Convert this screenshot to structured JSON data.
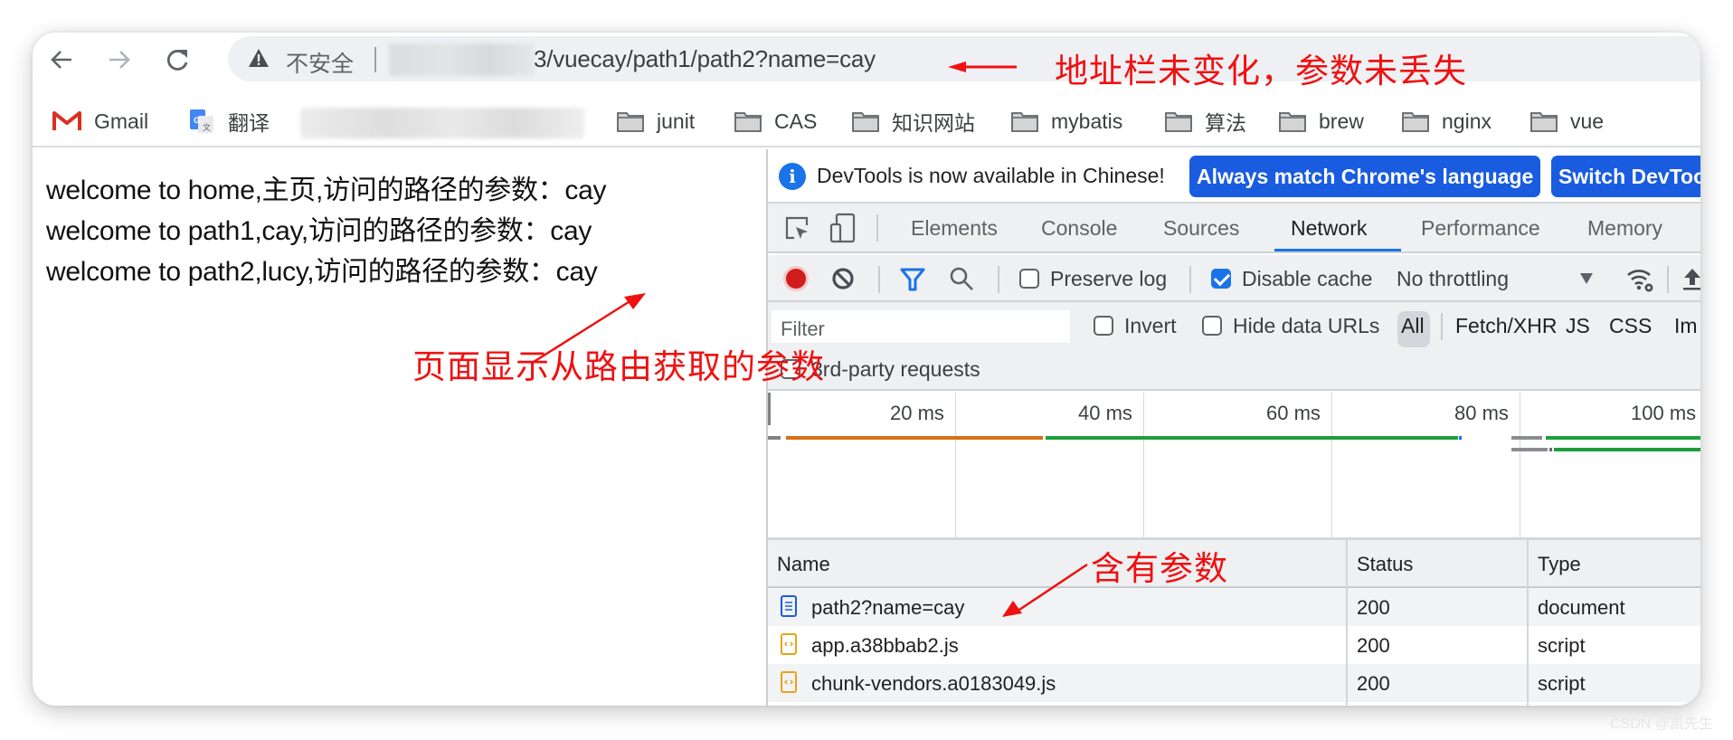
{
  "browser": {
    "nav": {
      "back_icon": "arrow-left-icon",
      "forward_icon": "arrow-right-icon",
      "reload_icon": "reload-icon"
    },
    "omnibox": {
      "security_icon": "warning-triangle-icon",
      "security_label": "不安全",
      "url_visible": "3/vuecay/path1/path2?name=cay"
    },
    "bookmarks": [
      {
        "label": "Gmail",
        "icon": "gmail-icon"
      },
      {
        "label": "翻译",
        "icon": "google-translate-icon"
      },
      {
        "label": "junit",
        "icon": "folder-icon"
      },
      {
        "label": "CAS",
        "icon": "folder-icon"
      },
      {
        "label": "知识网站",
        "icon": "folder-icon"
      },
      {
        "label": "mybatis",
        "icon": "folder-icon"
      },
      {
        "label": "算法",
        "icon": "folder-icon"
      },
      {
        "label": "brew",
        "icon": "folder-icon"
      },
      {
        "label": "nginx",
        "icon": "folder-icon"
      },
      {
        "label": "vue",
        "icon": "folder-icon"
      }
    ]
  },
  "page": {
    "lines": [
      "welcome to home,主页,访问的路径的参数：cay",
      "welcome to path1,cay,访问的路径的参数：cay",
      "welcome to path2,lucy,访问的路径的参数：cay"
    ]
  },
  "devtools": {
    "infobar": {
      "message": "DevTools is now available in Chinese!",
      "primary_button": "Always match Chrome's language",
      "secondary_button": "Switch DevTools to Chinese"
    },
    "tabs": [
      {
        "label": "Elements",
        "active": false
      },
      {
        "label": "Console",
        "active": false
      },
      {
        "label": "Sources",
        "active": false
      },
      {
        "label": "Network",
        "active": true
      },
      {
        "label": "Performance",
        "active": false
      },
      {
        "label": "Memory",
        "active": false
      }
    ],
    "network_toolbar": {
      "preserve_log_label": "Preserve log",
      "preserve_log_checked": false,
      "disable_cache_label": "Disable cache",
      "disable_cache_checked": true,
      "throttling_value": "No throttling"
    },
    "filter": {
      "placeholder": "Filter",
      "invert_label": "Invert",
      "invert_checked": false,
      "hide_data_urls_label": "Hide data URLs",
      "hide_data_urls_checked": false,
      "types": [
        "All",
        "Fetch/XHR",
        "JS",
        "CSS",
        "Im"
      ],
      "active_type": "All",
      "third_party_label": "3rd-party requests",
      "third_party_checked": false
    },
    "timeline": {
      "ticks": [
        "20 ms",
        "40 ms",
        "60 ms",
        "80 ms",
        "100 ms"
      ]
    },
    "table": {
      "columns": [
        "Name",
        "Status",
        "Type"
      ],
      "rows": [
        {
          "name": "path2?name=cay",
          "status": "200",
          "type": "document",
          "icon": "document-icon"
        },
        {
          "name": "app.a38bbab2.js",
          "status": "200",
          "type": "script",
          "icon": "script-icon"
        },
        {
          "name": "chunk-vendors.a0183049.js",
          "status": "200",
          "type": "script",
          "icon": "script-icon"
        }
      ]
    }
  },
  "annotations": {
    "address_bar_note": "地址栏未变化，参数未丢失",
    "page_note": "页面显示从路由获取的参数",
    "request_note": "含有参数"
  },
  "watermark": "CSDN @凯先生"
}
